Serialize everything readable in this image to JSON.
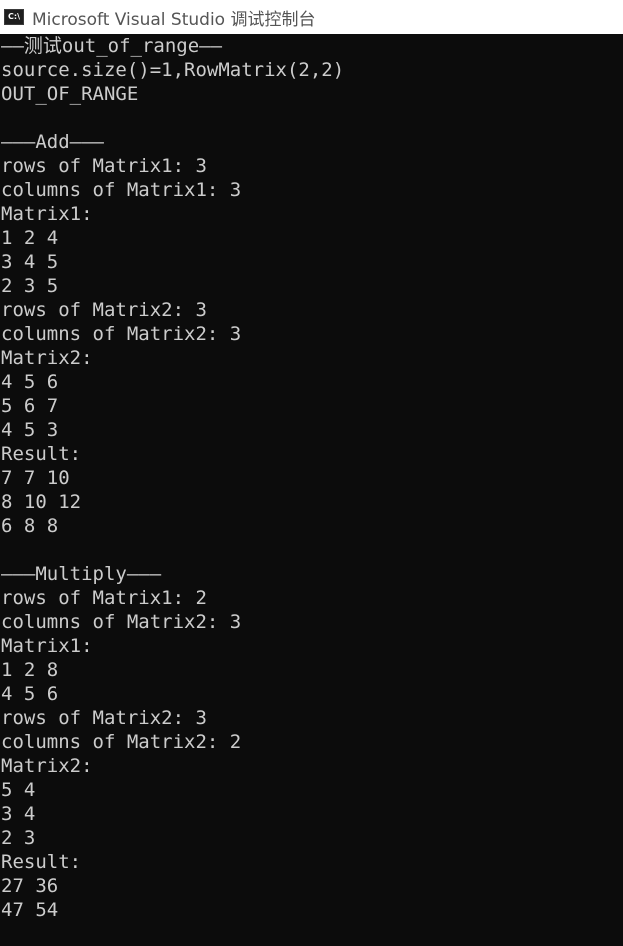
{
  "window": {
    "icon_text": "C:\\",
    "title": "Microsoft Visual Studio 调试控制台"
  },
  "console": {
    "lines": [
      "——测试out_of_range——",
      "source.size()=1,RowMatrix(2,2)",
      "OUT_OF_RANGE",
      "",
      "———Add———",
      "rows of Matrix1: 3",
      "columns of Matrix1: 3",
      "Matrix1:",
      "1 2 4",
      "3 4 5",
      "2 3 5",
      "rows of Matrix2: 3",
      "columns of Matrix2: 3",
      "Matrix2:",
      "4 5 6",
      "5 6 7",
      "4 5 3",
      "Result:",
      "7 7 10",
      "8 10 12",
      "6 8 8",
      "",
      "———Multiply———",
      "rows of Matrix1: 2",
      "columns of Matrix2: 3",
      "Matrix1:",
      "1 2 8",
      "4 5 6",
      "rows of Matrix2: 3",
      "columns of Matrix2: 2",
      "Matrix2:",
      "5 4",
      "3 4",
      "2 3",
      "Result:",
      "27 36",
      "47 54"
    ]
  }
}
